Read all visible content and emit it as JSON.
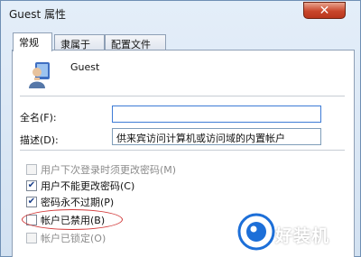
{
  "window": {
    "title": "Guest 属性",
    "close_symbol": "✕"
  },
  "tabs": [
    {
      "label": "常规",
      "active": true
    },
    {
      "label": "隶属于",
      "active": false
    },
    {
      "label": "配置文件",
      "active": false
    }
  ],
  "user": {
    "name": "Guest",
    "icon": "user-icon"
  },
  "fields": {
    "full_name_label": "全名(F):",
    "full_name_value": "",
    "description_label": "描述(D):",
    "description_value": "供来宾访问计算机或访问域的内置帐户"
  },
  "checkboxes": [
    {
      "label": "用户下次登录时须更改密码(M)",
      "checked": false,
      "disabled": true
    },
    {
      "label": "用户不能更改密码(C)",
      "checked": true,
      "disabled": false
    },
    {
      "label": "密码永不过期(P)",
      "checked": true,
      "disabled": false
    },
    {
      "label": "帐户已禁用(B)",
      "checked": false,
      "disabled": false
    },
    {
      "label": "帐户已锁定(O)",
      "checked": false,
      "disabled": true
    }
  ],
  "watermark": {
    "text": "好装机",
    "icon": "watermark-logo-icon"
  },
  "colors": {
    "highlight_circle": "#d23a3a",
    "close_button": "#c9462b"
  }
}
